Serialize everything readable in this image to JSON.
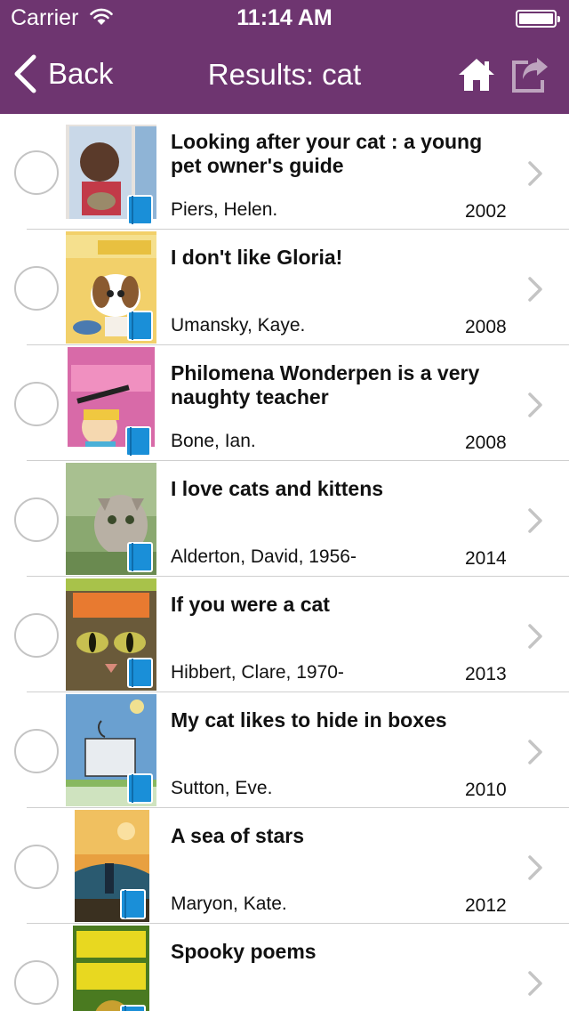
{
  "status_bar": {
    "carrier": "Carrier",
    "time": "11:14 AM"
  },
  "nav": {
    "back_label": "Back",
    "title": "Results: cat"
  },
  "colors": {
    "bar": "#6e3570",
    "separator": "#cfcfcf",
    "radio": "#c4c4c4",
    "book_icon": "#1a8fd8"
  },
  "icons": {
    "status": [
      "wifi-icon",
      "battery-icon"
    ],
    "nav": [
      "back-chevron-icon",
      "home-icon",
      "share-icon"
    ],
    "row": [
      "select-radio",
      "cover-image",
      "ebook-icon",
      "chevron-right-icon"
    ]
  },
  "results": [
    {
      "title": "Looking after your cat : a young pet owner's guide",
      "author": "Piers, Helen.",
      "year": "2002"
    },
    {
      "title": "I don't like Gloria!",
      "author": "Umansky, Kaye.",
      "year": "2008"
    },
    {
      "title": "Philomena Wonderpen is a very naughty teacher",
      "author": "Bone, Ian.",
      "year": "2008"
    },
    {
      "title": "I love cats and kittens",
      "author": "Alderton, David, 1956-",
      "year": "2014"
    },
    {
      "title": "If you were a cat",
      "author": "Hibbert, Clare, 1970-",
      "year": "2013"
    },
    {
      "title": "My cat likes to hide in boxes",
      "author": "Sutton, Eve.",
      "year": "2010"
    },
    {
      "title": "A sea of stars",
      "author": "Maryon, Kate.",
      "year": "2012"
    },
    {
      "title": "Spooky poems",
      "author": "",
      "year": ""
    }
  ]
}
